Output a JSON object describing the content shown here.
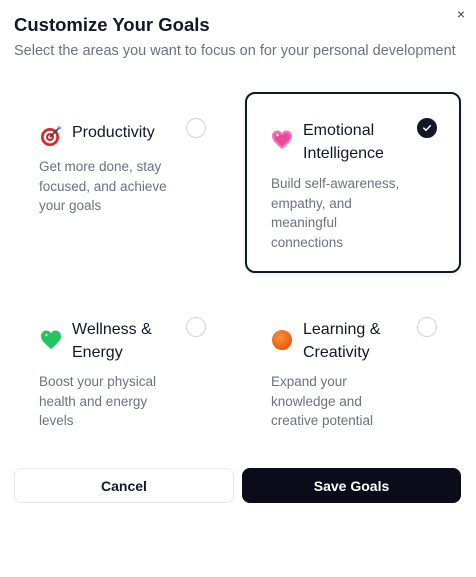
{
  "dialog": {
    "title": "Customize Your Goals",
    "subtitle": "Select the areas you want to focus on for your personal development",
    "close_glyph": "×",
    "close_icon": "close-icon"
  },
  "goals": [
    {
      "icon": "target-icon",
      "title": "Productivity",
      "description": "Get more done, stay\nfocused, and achieve\nyour goals",
      "selected": false
    },
    {
      "icon": "pink-heart-icon",
      "title": "Emotional\nIntelligence",
      "description": "Build self-awareness,\nempathy, and\nmeaningful\nconnections",
      "selected": true
    },
    {
      "icon": "green-heart-icon",
      "title": "Wellness &\nEnergy",
      "description": "Boost your physical\nhealth and energy\nlevels",
      "selected": false
    },
    {
      "icon": "orange-circle-icon",
      "title": "Learning &\nCreativity",
      "description": "Expand your\nknowledge and\ncreative potential",
      "selected": false
    }
  ],
  "actions": {
    "cancel_label": "Cancel",
    "save_label": "Save Goals"
  },
  "colors": {
    "primary": "#0b0b1a",
    "muted_text": "#6b7280",
    "border": "#e5e7eb"
  }
}
